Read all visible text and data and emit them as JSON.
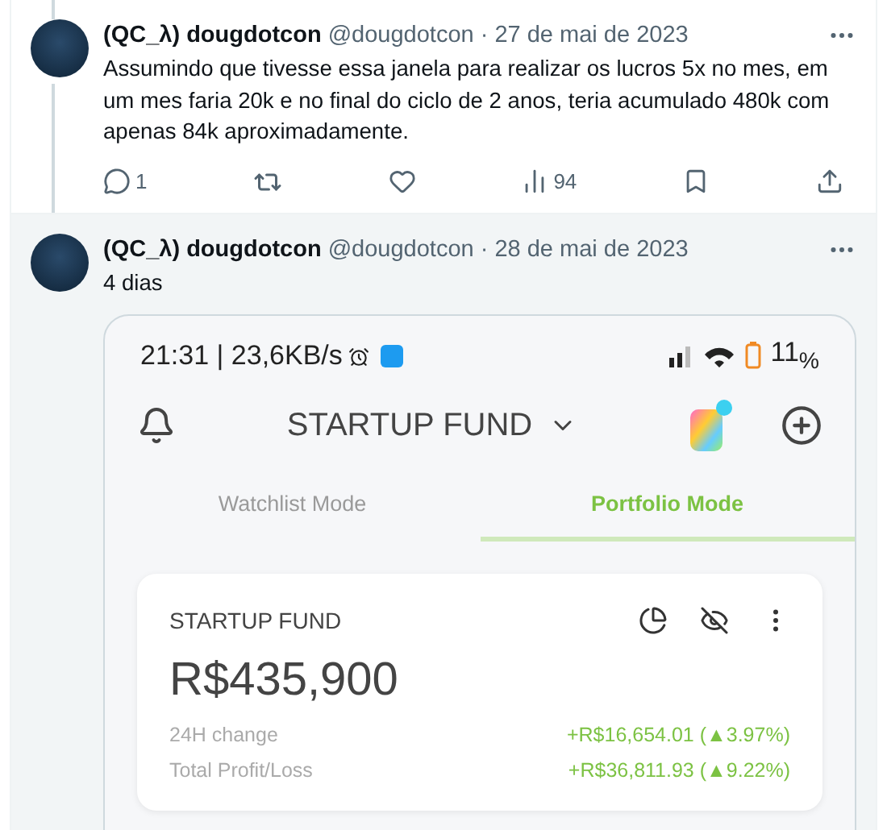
{
  "tweets": [
    {
      "author": "(QC_λ) dougdotcon",
      "handle": "@dougdotcon",
      "date": "· 27 de mai de 2023",
      "text": "Assumindo que tivesse essa janela para realizar os lucros 5x no mes, em um mes faria 20k e no final do ciclo de 2 anos, teria acumulado 480k com apenas 84k aproximadamente.",
      "thread_line": true,
      "highlighted": false,
      "actions": [
        {
          "kind": "reply",
          "count": "1"
        },
        {
          "kind": "retweet"
        },
        {
          "kind": "like"
        },
        {
          "kind": "views",
          "count": "94"
        },
        {
          "kind": "bookmark"
        },
        {
          "kind": "share"
        }
      ]
    },
    {
      "author": "(QC_λ) dougdotcon",
      "handle": "@dougdotcon",
      "date": "· 28 de mai de 2023",
      "text": "4 dias",
      "thread_line": false,
      "highlighted": true,
      "screenshot": {
        "status_bar": {
          "time": "21:31 | 23,6KB/s",
          "battery": "11$_{%}$"
        },
        "header": {
          "title": "STARTUP FUND"
        },
        "tabs": [
          {
            "label": "Watchlist Mode",
            "selected": false
          },
          {
            "label": "Portfolio Mode",
            "selected": true
          }
        ],
        "card": {
          "title": "STARTUP FUND",
          "value": "R$435,900",
          "rows": [
            {
              "label": "24H change",
              "value": "+R$16,654.01 (▲3.97%)"
            },
            {
              "label": "Total Profit/Loss",
              "value": "+R$36,811.93 (▲9.22%)"
            }
          ]
        }
      }
    }
  ]
}
